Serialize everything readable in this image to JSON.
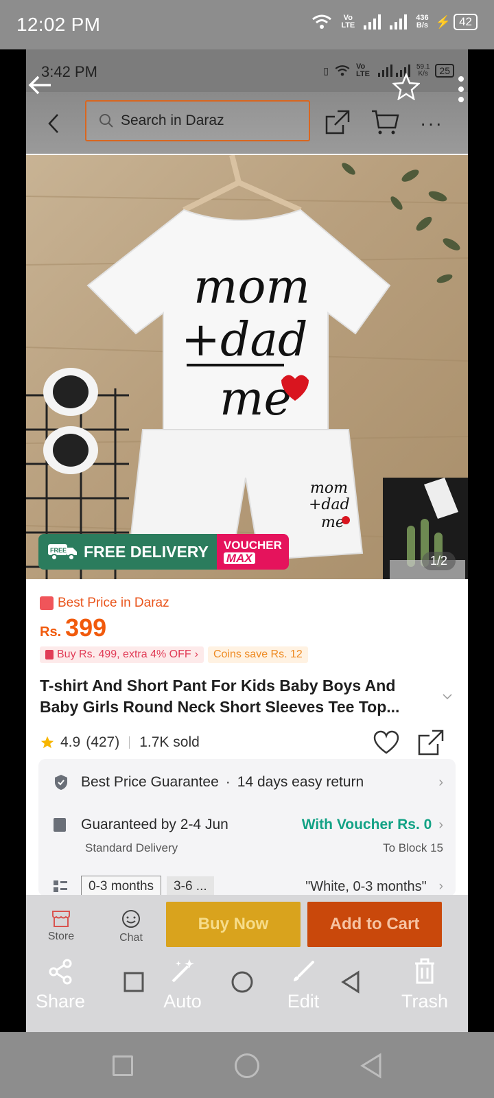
{
  "os_status": {
    "time": "12:02 PM",
    "network_label": "Vo LTE",
    "speed_value": "436",
    "speed_unit": "B/s",
    "battery": "42"
  },
  "inner_status": {
    "time": "3:42 PM",
    "network_label": "Vo LTE",
    "speed_value": "59.1",
    "speed_unit": "K/s",
    "battery": "25"
  },
  "search": {
    "placeholder": "Search in Daraz"
  },
  "product": {
    "badge_free_delivery": "FREE DELIVERY",
    "badge_free_icon_text": "FREE",
    "badge_voucher": "VOUCHER",
    "badge_max": "MAX",
    "pager": "1/2",
    "shirt_text": [
      "mom",
      "+dad",
      "me"
    ],
    "best_price_label": "Best Price in Daraz",
    "currency": "Rs.",
    "price": "399",
    "promo_extra": "Buy Rs. 499, extra 4% OFF",
    "promo_coins": "Coins save Rs. 12",
    "title": "T-shirt And Short Pant For Kids Baby Boys And Baby Girls Round Neck Short Sleeves Tee Top...",
    "rating": "4.9",
    "reviews": "(427)",
    "sold": "1.7K sold"
  },
  "services": {
    "guarantee": "Best Price Guarantee",
    "dot": "·",
    "returns": "14 days easy return",
    "delivery": "Guaranteed by 2-4 Jun",
    "voucher": "With Voucher Rs. 0",
    "delivery_type": "Standard Delivery",
    "destination": "To Block 15",
    "variant_1": "0-3 months",
    "variant_2": "3-6 ...",
    "selected_variant": "\"White, 0-3 months\""
  },
  "action_bar": {
    "store": "Store",
    "chat": "Chat",
    "buy_now": "Buy Now",
    "add_to_cart": "Add to Cart"
  },
  "viewer_toolbar": {
    "share": "Share",
    "auto": "Auto",
    "edit": "Edit",
    "trash": "Trash"
  },
  "colors": {
    "accent_orange": "#f15a0c",
    "voucher_green": "#12a285",
    "buy_now_bg": "#d9a31d",
    "add_cart_bg": "#c9480b"
  }
}
